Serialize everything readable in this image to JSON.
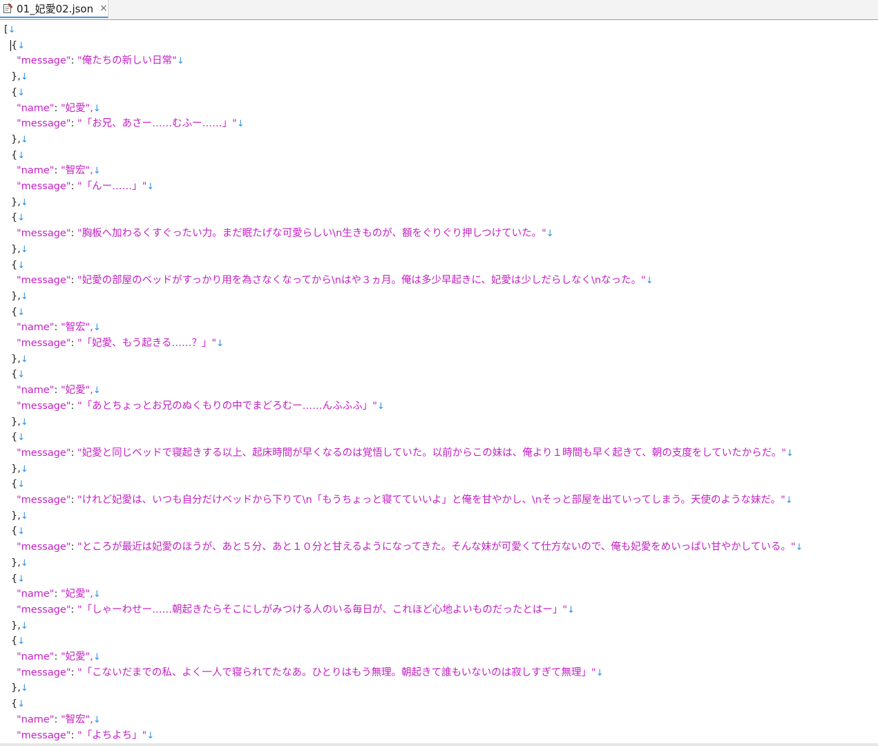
{
  "tab": {
    "title": "01_妃愛02.json",
    "close_glyph": "×"
  },
  "colors": {
    "key": "#c420c4",
    "string": "#c420c4",
    "arrow": "#2f8fe0",
    "tab_accent": "#4a90d9"
  },
  "newline_glyph": "↓",
  "entries": [
    {
      "message": "俺たちの新しい日常"
    },
    {
      "name": "妃愛",
      "message": "「お兄、あさー……むふー……」"
    },
    {
      "name": "智宏",
      "message": "「んー……」"
    },
    {
      "message": "胸板へ加わるくすぐったい力。まだ眠たげな可愛らしい\\n生きものが、額をぐりぐり押しつけていた。"
    },
    {
      "message": "妃愛の部屋のベッドがすっかり用を為さなくなってから\\nはや３ヵ月。俺は多少早起きに、妃愛は少しだらしなく\\nなった。"
    },
    {
      "name": "智宏",
      "message": "「妃愛、もう起きる……？」"
    },
    {
      "name": "妃愛",
      "message": "「あとちょっとお兄のぬくもりの中でまどろむー……んふふふ」"
    },
    {
      "message": "妃愛と同じベッドで寝起きする以上、起床時間が早くなるのは覚悟していた。以前からこの妹は、俺より１時間も早く起きて、朝の支度をしていたからだ。"
    },
    {
      "message": "けれど妃愛は、いつも自分だけベッドから下りて\\n「もうちょっと寝てていいよ」と俺を甘やかし、\\nそっと部屋を出ていってしまう。天使のような妹だ。"
    },
    {
      "message": "ところが最近は妃愛のほうが、あと５分、あと１０分と甘えるようになってきた。そんな妹が可愛くて仕方ないので、俺も妃愛をめいっぱい甘やかしている。"
    },
    {
      "name": "妃愛",
      "message": "「しゃーわせー……朝起きたらそこにしがみつける人のいる毎日が、これほど心地よいものだったとはー」"
    },
    {
      "name": "妃愛",
      "message": "「こないだまでの私、よく一人で寝られてたなあ。ひとりはもう無理。朝起きて誰もいないのは寂しすぎて無理」"
    },
    {
      "name": "智宏",
      "message": "「よちよち」"
    }
  ]
}
